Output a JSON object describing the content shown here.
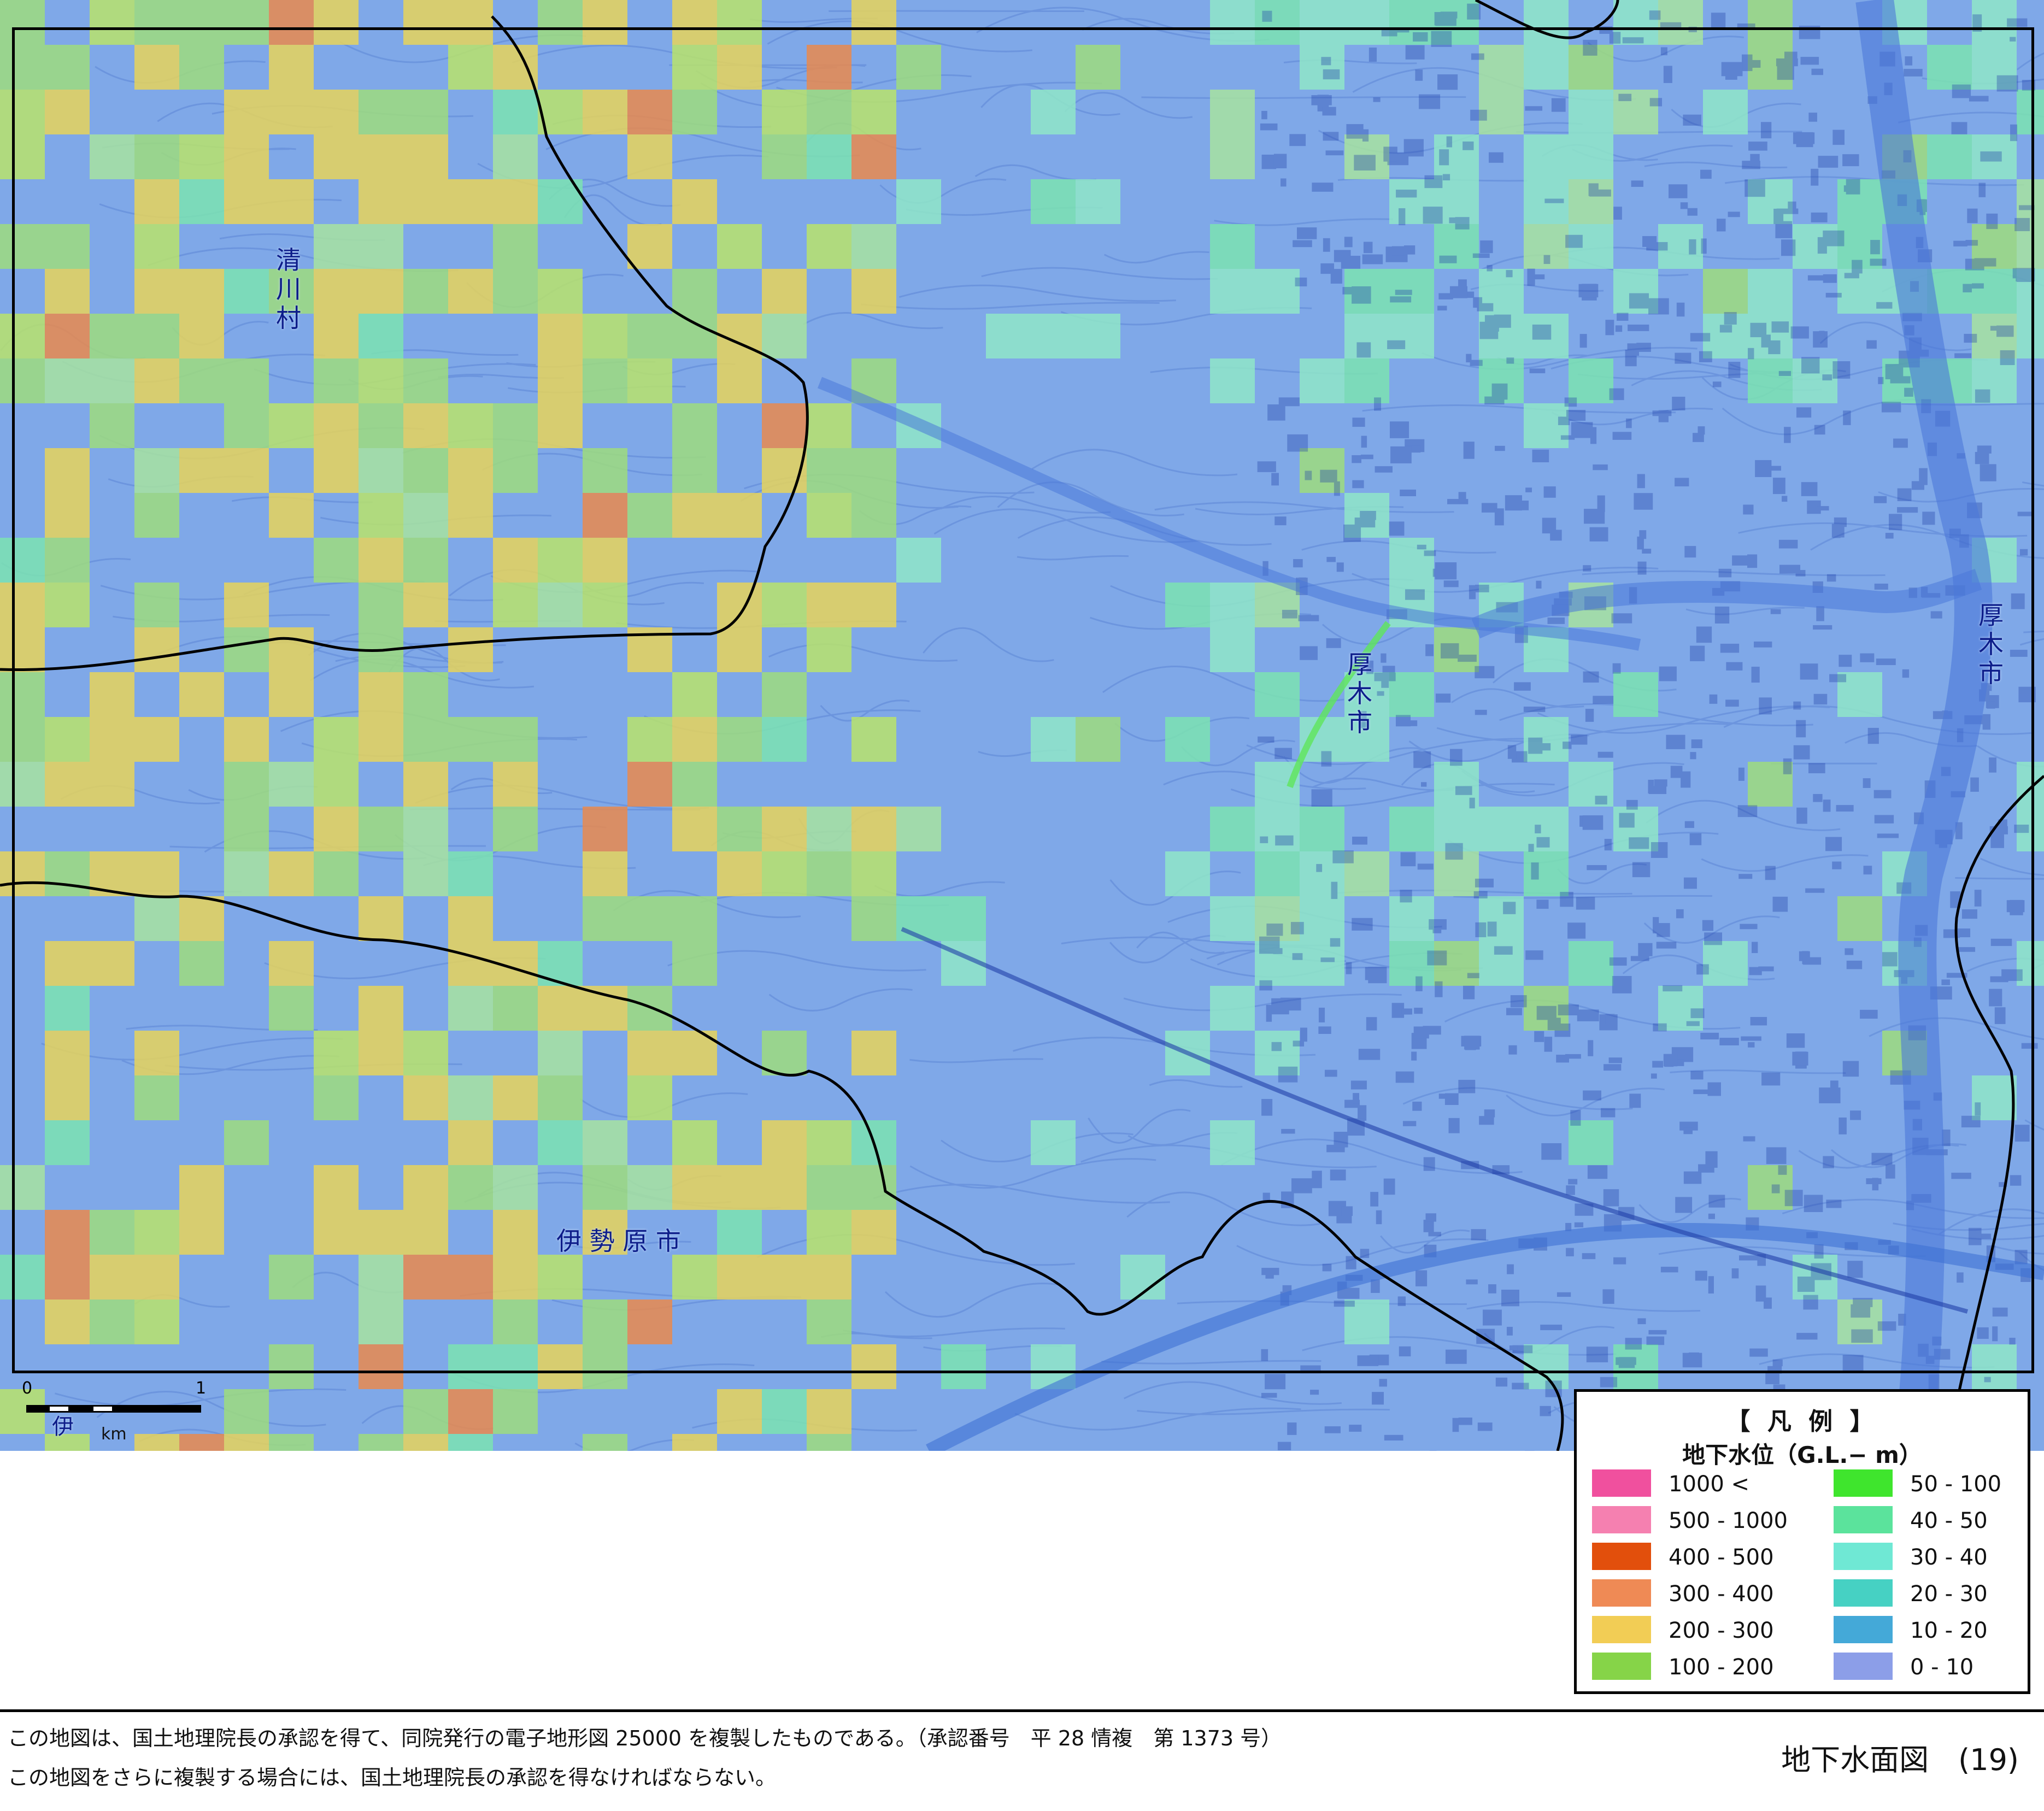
{
  "map": {
    "place_labels": [
      {
        "id": "kiyokawa",
        "text": "清\n川\n村"
      },
      {
        "id": "atsugi-center",
        "text": "厚\n木\n市"
      },
      {
        "id": "atsugi-east",
        "text": "厚\n木\n市"
      },
      {
        "id": "isehara",
        "text": "伊 勢 原 市"
      },
      {
        "id": "isehara-edge",
        "text": "伊"
      }
    ],
    "scale": {
      "start": "0",
      "end": "1",
      "unit": "km"
    },
    "colors": {
      "base": "#7fa8e8",
      "grid_cells": [
        "#9edc7e",
        "#b8e36b",
        "#e6d35a",
        "#eeb55a",
        "#e98a4e",
        "#7be3b2",
        "#8fe6c8",
        "#a7e3a0"
      ]
    }
  },
  "legend": {
    "title": "【 凡 例 】",
    "subtitle": "地下水位（G.L.− m）",
    "items": [
      {
        "label": "1000 <",
        "color": "#f0509e"
      },
      {
        "label": "500 - 1000",
        "color": "#f580b0"
      },
      {
        "label": "400 - 500",
        "color": "#e24f0c"
      },
      {
        "label": "300 - 400",
        "color": "#ef8a55"
      },
      {
        "label": "200 - 300",
        "color": "#f2cd55"
      },
      {
        "label": "100 - 200",
        "color": "#86d448"
      },
      {
        "label": "50 - 100",
        "color": "#3fe52d"
      },
      {
        "label": "40 - 50",
        "color": "#5be39c"
      },
      {
        "label": "30 - 40",
        "color": "#6fe8d4"
      },
      {
        "label": "20 - 30",
        "color": "#46d1c3"
      },
      {
        "label": "10 - 20",
        "color": "#44a9d8"
      },
      {
        "label": "0 - 10",
        "color": "#8c9ee8"
      }
    ]
  },
  "footer": {
    "note_1": "この地図は、国土地理院長の承認を得て、同院発行の電子地形図 25000 を複製したものである。（承認番号　平 28 情複　第 1373 号）",
    "note_2": "この地図をさらに複製する場合には、国土地理院長の承認を得なければならない。",
    "sheet_title": "地下水面図　(19)"
  }
}
